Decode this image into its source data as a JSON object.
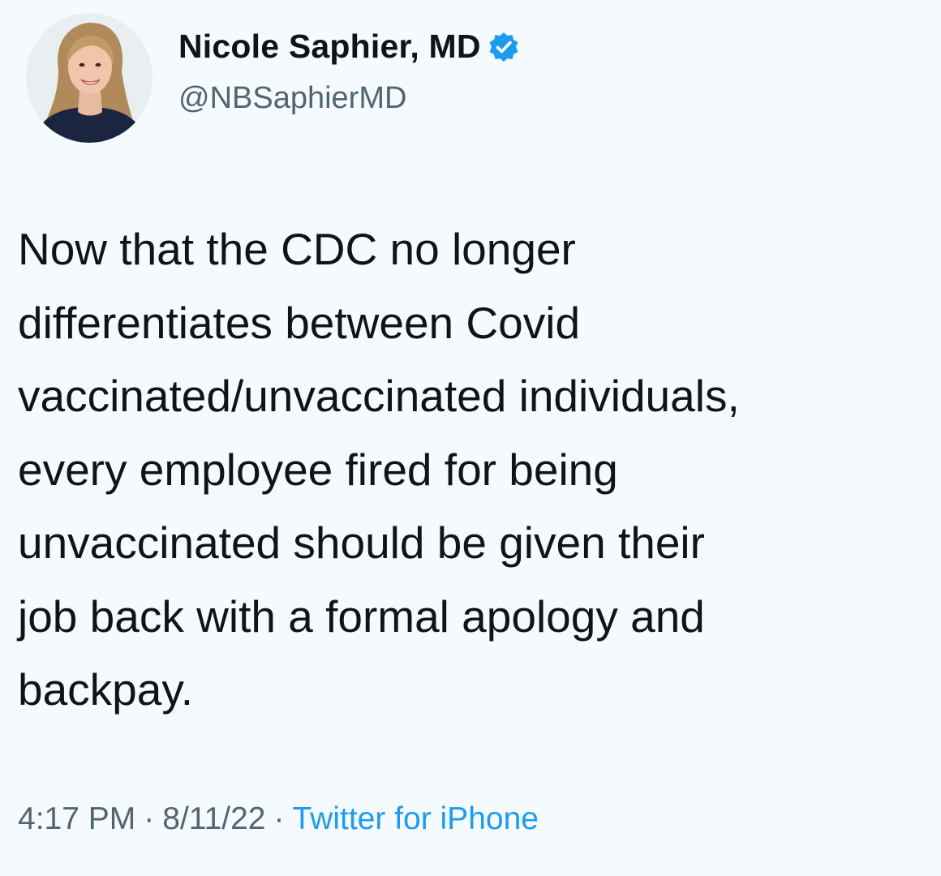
{
  "author": {
    "display_name": "Nicole Saphier, MD",
    "handle": "@NBSaphierMD",
    "verified": true,
    "avatar_icon": "profile-photo"
  },
  "tweet": {
    "lines": [
      "Now that the CDC no longer",
      "differentiates between Covid",
      "vaccinated/unvaccinated individuals,",
      "every employee fired for being",
      "unvaccinated should be given their",
      "job back with a formal apology and",
      "backpay."
    ]
  },
  "meta": {
    "time": "4:17 PM",
    "date": "8/11/22",
    "source": "Twitter for iPhone",
    "separator": "·"
  },
  "colors": {
    "background": "#f4fafd",
    "text": "#0f1419",
    "secondary": "#536471",
    "accent": "#1d9bf0"
  }
}
